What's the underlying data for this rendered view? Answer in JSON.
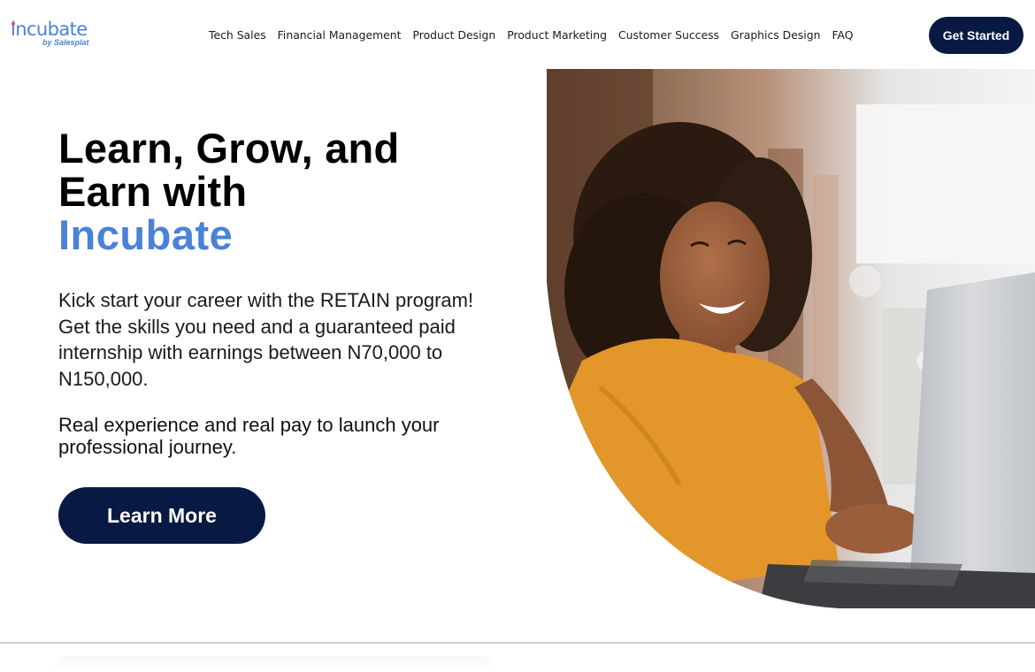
{
  "logo": {
    "name": "incubate",
    "tagline": "by Salesplat"
  },
  "nav": {
    "links": [
      "Tech Sales",
      "Financial Management",
      "Product Design",
      "Product Marketing",
      "Customer Success",
      "Graphics Design",
      "FAQ"
    ]
  },
  "header": {
    "cta_label": "Get Started"
  },
  "hero": {
    "title_line1": "Learn, Grow, and",
    "title_line2": "Earn with",
    "title_accent": "Incubate",
    "paragraph1": "Kick start your career with the RETAIN program! Get the skills you need and a guaranteed paid internship with earnings between N70,000 to N150,000.",
    "paragraph2": "Real experience and real pay to launch your professional journey.",
    "cta_label": "Learn More"
  },
  "colors": {
    "accent": "#4a82d8",
    "button_navy": "#081a43",
    "logo_dot": "#e94b6a",
    "shirt": "#e3972a"
  }
}
